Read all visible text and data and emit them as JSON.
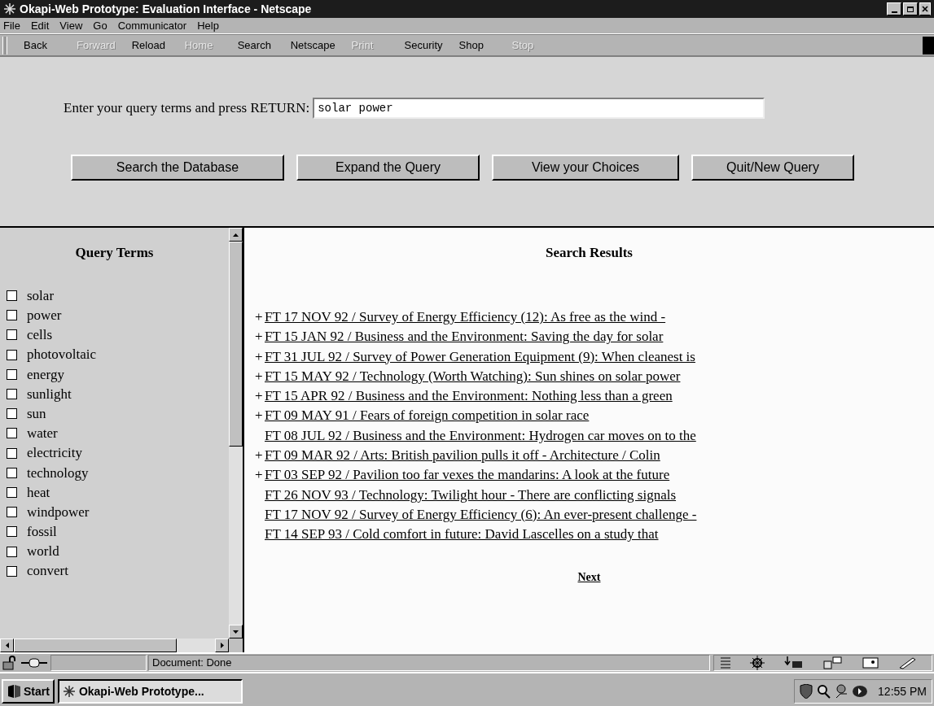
{
  "window": {
    "title": "Okapi-Web Prototype: Evaluation Interface - Netscape"
  },
  "menu": [
    "File",
    "Edit",
    "View",
    "Go",
    "Communicator",
    "Help"
  ],
  "toolbar": [
    {
      "label": "Back",
      "disabled": false
    },
    {
      "label": "Forward",
      "disabled": true
    },
    {
      "label": "Reload",
      "disabled": false
    },
    {
      "label": "Home",
      "disabled": true
    },
    {
      "label": "Search",
      "disabled": false
    },
    {
      "label": "Netscape",
      "disabled": false
    },
    {
      "label": "Print",
      "disabled": true
    },
    {
      "label": "Security",
      "disabled": false
    },
    {
      "label": "Shop",
      "disabled": false
    },
    {
      "label": "Stop",
      "disabled": true
    }
  ],
  "query": {
    "label": "Enter your query terms and press RETURN:",
    "value": "solar power"
  },
  "buttons": [
    "Search the Database",
    "Expand the Query",
    "View your Choices",
    "Quit/New Query"
  ],
  "query_terms": {
    "title": "Query Terms",
    "items": [
      {
        "label": "solar",
        "checked": false
      },
      {
        "label": "power",
        "checked": false
      },
      {
        "label": "cells",
        "checked": false
      },
      {
        "label": "photovoltaic",
        "checked": false
      },
      {
        "label": "energy",
        "checked": false
      },
      {
        "label": "sunlight",
        "checked": false
      },
      {
        "label": "sun",
        "checked": false
      },
      {
        "label": "water",
        "checked": false
      },
      {
        "label": "electricity",
        "checked": false
      },
      {
        "label": "technology",
        "checked": false
      },
      {
        "label": "heat",
        "checked": false
      },
      {
        "label": "windpower",
        "checked": false
      },
      {
        "label": "fossil",
        "checked": false
      },
      {
        "label": "world",
        "checked": false
      },
      {
        "label": "convert",
        "checked": false
      }
    ]
  },
  "results": {
    "title": "Search Results",
    "items": [
      {
        "marker": "+",
        "text": "FT 17 NOV 92 / Survey of Energy Efficiency (12): As free as the wind -"
      },
      {
        "marker": "+",
        "text": "FT 15 JAN 92 / Business and the Environment: Saving the day for solar"
      },
      {
        "marker": "+",
        "text": "FT 31 JUL 92 / Survey of Power Generation Equipment (9): When cleanest is"
      },
      {
        "marker": "+",
        "text": "FT 15 MAY 92 / Technology (Worth Watching): Sun shines on solar power"
      },
      {
        "marker": "+",
        "text": "FT 15 APR 92 / Business and the Environment: Nothing less than a green"
      },
      {
        "marker": "+",
        "text": "FT 09 MAY 91 / Fears of foreign competition in solar race"
      },
      {
        "text": "FT 08 JUL 92 / Business and the Environment: Hydrogen car moves on to the"
      },
      {
        "marker": "+",
        "text": "FT 09 MAR 92 / Arts: British pavilion pulls it off - Architecture / Colin"
      },
      {
        "marker": "+",
        "text": "FT 03 SEP 92 / Pavilion too far vexes the mandarins: A look at the future"
      },
      {
        "text": "FT 26 NOV 93 / Technology: Twilight hour - There are conflicting signals"
      },
      {
        "text": "FT 17 NOV 92 / Survey of Energy Efficiency (6): An ever-present challenge -"
      },
      {
        "text": "FT 14 SEP 93 / Cold comfort in future: David Lascelles on a study that"
      }
    ],
    "next": "Next"
  },
  "status_bar": {
    "text": "Document: Done"
  },
  "taskbar": {
    "start": "Start",
    "task": "Okapi-Web Prototype...",
    "clock": "12:55 PM"
  }
}
